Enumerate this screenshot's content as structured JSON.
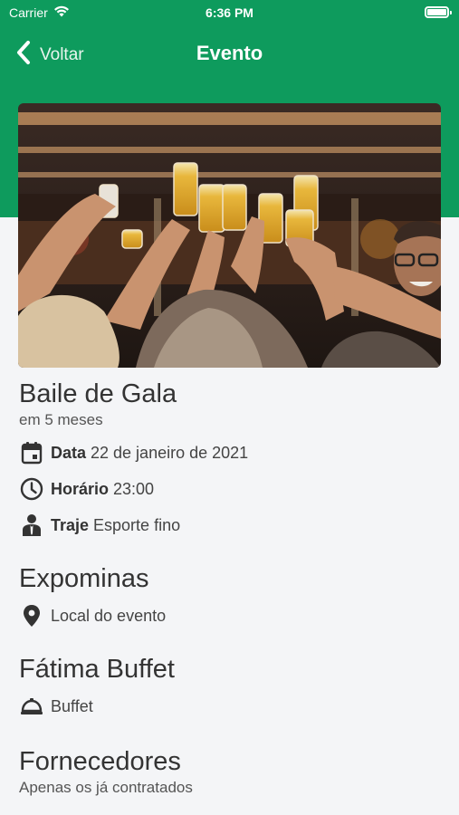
{
  "status_bar": {
    "carrier": "Carrier",
    "time": "6:36 PM"
  },
  "nav": {
    "back_label": "Voltar",
    "title": "Evento"
  },
  "event": {
    "name": "Baile de Gala",
    "relative_date": "em 5 meses",
    "date_label": "Data",
    "date_value": "22 de janeiro de 2021",
    "time_label": "Horário",
    "time_value": "23:00",
    "dress_label": "Traje",
    "dress_value": "Esporte fino"
  },
  "venue": {
    "name": "Expominas",
    "caption": "Local do evento"
  },
  "buffet": {
    "name": "Fátima Buffet",
    "caption": "Buffet"
  },
  "suppliers": {
    "title": "Fornecedores",
    "subtitle": "Apenas os já contratados"
  },
  "colors": {
    "brand_green": "#0e9b5d",
    "background": "#f4f5f7"
  }
}
